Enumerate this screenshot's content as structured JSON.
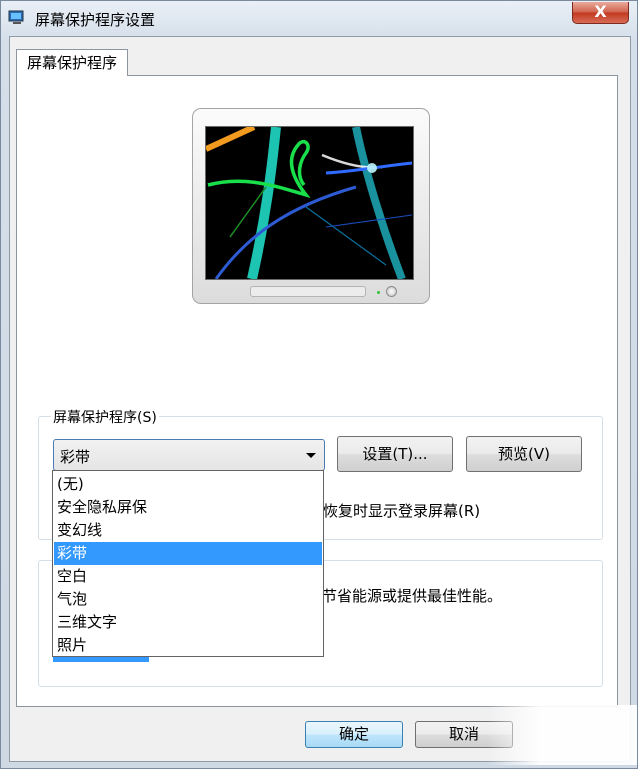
{
  "window": {
    "title": "屏幕保护程序设置",
    "close_label": "X"
  },
  "tabs": [
    {
      "label": "屏幕保护程序"
    }
  ],
  "screensaver_group": {
    "label": "屏幕保护程序(S)",
    "selected": "彩带",
    "settings_button": "设置(T)...",
    "preview_button": "预览(V)",
    "resume_text_visible": "恢复时显示登录屏幕(R)"
  },
  "power_group": {
    "text_visible": "节省能源或提供最佳性能。"
  },
  "dropdown": {
    "options": [
      "(无)",
      "安全隐私屏保",
      "变幻线",
      "彩带",
      "空白",
      "气泡",
      "三维文字",
      "照片"
    ],
    "selected_index": 3
  },
  "footer": {
    "ok_button": "确定",
    "cancel_button": "取消"
  },
  "colors": {
    "selection": "#3399ff",
    "close_button": "#c1381f"
  }
}
